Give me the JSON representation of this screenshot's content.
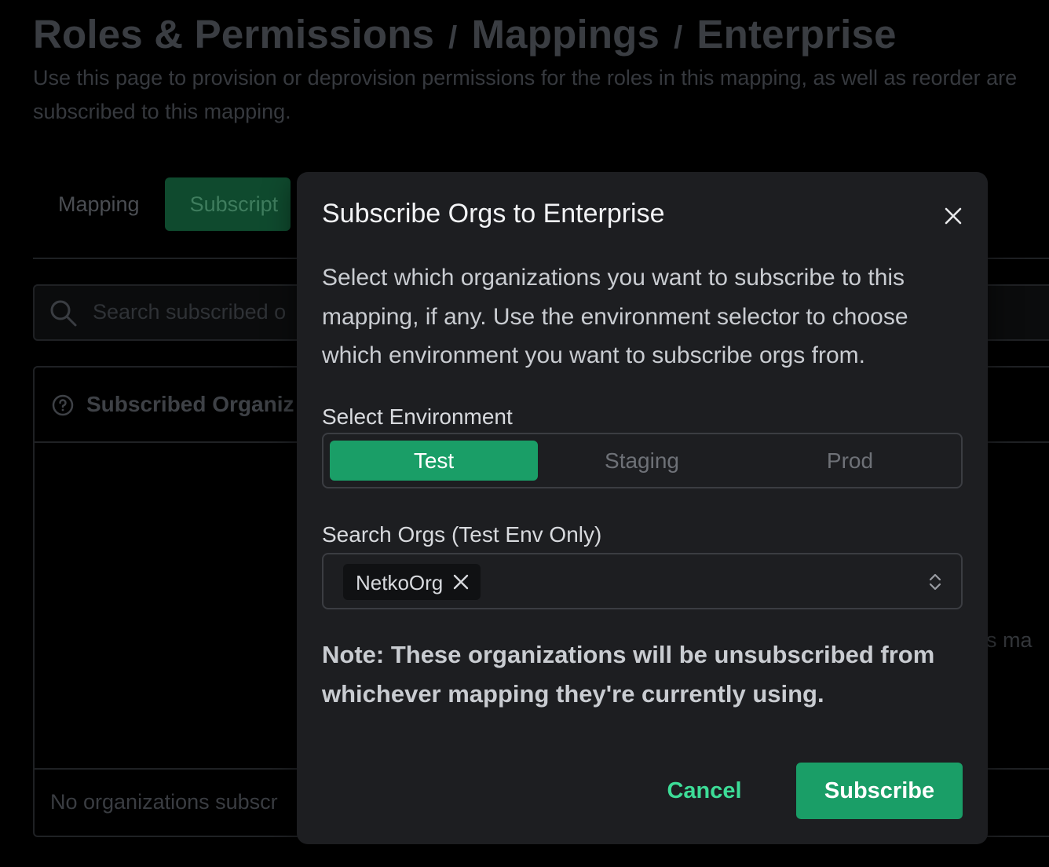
{
  "colors": {
    "accent": "#1a9e67",
    "accent_text": "#3ddc97",
    "modal_bg": "#1d1e21",
    "page_bg": "#000000"
  },
  "breadcrumb": {
    "items": [
      "Roles & Permissions",
      "Mappings",
      "Enterprise"
    ],
    "separator": "/"
  },
  "page": {
    "description": "Use this page to provision or deprovision permissions for the roles in this mapping, as well as reorder are subscribed to this mapping."
  },
  "tabs": [
    {
      "label": "Mapping",
      "active": false
    },
    {
      "label": "Subscript",
      "active": true
    }
  ],
  "search": {
    "placeholder": "Search subscribed o",
    "icon": "search-icon"
  },
  "orgs_card": {
    "title": "Subscribed Organiz",
    "help_icon": "help-circle-icon",
    "empty_text": "is ma",
    "footer_text": "No organizations subscr"
  },
  "modal": {
    "title": "Subscribe Orgs to Enterprise",
    "close_icon": "close-icon",
    "description": "Select which organizations you want to subscribe to this mapping, if any. Use the environment selector to choose which environment you want to subscribe orgs from.",
    "env_label": "Select Environment",
    "environments": [
      {
        "label": "Test",
        "selected": true
      },
      {
        "label": "Staging",
        "selected": false
      },
      {
        "label": "Prod",
        "selected": false
      }
    ],
    "search_label": "Search Orgs (Test Env Only)",
    "selected_orgs": [
      "NetkoOrg"
    ],
    "chevrons_icon": "chevrons-up-down-icon",
    "note": "Note: These organizations will be unsubscribed from whichever mapping they're currently using.",
    "cancel_label": "Cancel",
    "subscribe_label": "Subscribe"
  }
}
